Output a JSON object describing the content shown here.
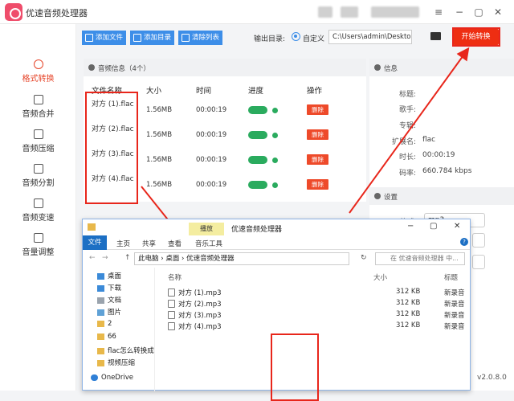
{
  "app": {
    "title": "优速音频处理器",
    "version": "v2.0.8.0"
  },
  "sidebar": {
    "items": [
      {
        "label": "格式转换",
        "icon": "convert-icon",
        "active": true
      },
      {
        "label": "音频合并",
        "icon": "merge-icon"
      },
      {
        "label": "音频压缩",
        "icon": "compress-icon"
      },
      {
        "label": "音频分割",
        "icon": "split-icon"
      },
      {
        "label": "音频变速",
        "icon": "speed-icon"
      },
      {
        "label": "音量调整",
        "icon": "volume-icon"
      }
    ]
  },
  "toolbar": {
    "add_file": "添加文件",
    "add_folder": "添加目录",
    "clear_list": "清除列表",
    "output_label": "输出目录:",
    "custom_label": "自定义",
    "output_path": "C:\\Users\\admin\\Deskto",
    "start_button": "开始转换"
  },
  "audio_panel": {
    "title": "音频信息（4个）",
    "columns": [
      "文件名称",
      "大小",
      "时间",
      "进度",
      "操作"
    ],
    "rows": [
      {
        "name": "对方 (1).flac",
        "size": "1.56MB",
        "time": "00:00:19",
        "action": "删除"
      },
      {
        "name": "对方 (2).flac",
        "size": "1.56MB",
        "time": "00:00:19",
        "action": "删除"
      },
      {
        "name": "对方 (3).flac",
        "size": "1.56MB",
        "time": "00:00:19",
        "action": "删除"
      },
      {
        "name": "对方 (4).flac",
        "size": "1.56MB",
        "time": "00:00:19",
        "action": "删除"
      }
    ]
  },
  "info_panel": {
    "title": "信息",
    "fields": [
      {
        "key": "标题:",
        "value": ""
      },
      {
        "key": "歌手:",
        "value": ""
      },
      {
        "key": "专辑:",
        "value": ""
      },
      {
        "key": "扩展名:",
        "value": "flac"
      },
      {
        "key": "时长:",
        "value": "00:00:19"
      },
      {
        "key": "码率:",
        "value": "660.784 kbps"
      }
    ]
  },
  "settings_panel": {
    "title": "设置",
    "format_label": "格式:",
    "format_value": "mp3"
  },
  "explorer": {
    "title": "优速音频处理器",
    "play_tab": "播放",
    "tabs": [
      "文件",
      "主页",
      "共享",
      "查看",
      "音乐工具"
    ],
    "address": [
      "此电脑",
      "桌面",
      "优速音频处理器"
    ],
    "search_placeholder": "在 优速音频处理器 中...",
    "nav": [
      "桌面",
      "下载",
      "文档",
      "图片",
      "2",
      "66",
      "flac怎么转换成",
      "视频压缩",
      "OneDrive"
    ],
    "columns": [
      "名称",
      "大小",
      "标题"
    ],
    "files": [
      {
        "name": "对方 (1).mp3",
        "size": "312 KB",
        "tag": "新录音"
      },
      {
        "name": "对方 (2).mp3",
        "size": "312 KB",
        "tag": "新录音"
      },
      {
        "name": "对方 (3).mp3",
        "size": "312 KB",
        "tag": "新录音"
      },
      {
        "name": "对方 (4).mp3",
        "size": "312 KB",
        "tag": "新录音"
      }
    ]
  },
  "colors": {
    "accent": "#3d8ee8",
    "start": "#ee2e12",
    "progress": "#2aab5e",
    "annotation": "#e8261b",
    "active": "#e6452a"
  }
}
